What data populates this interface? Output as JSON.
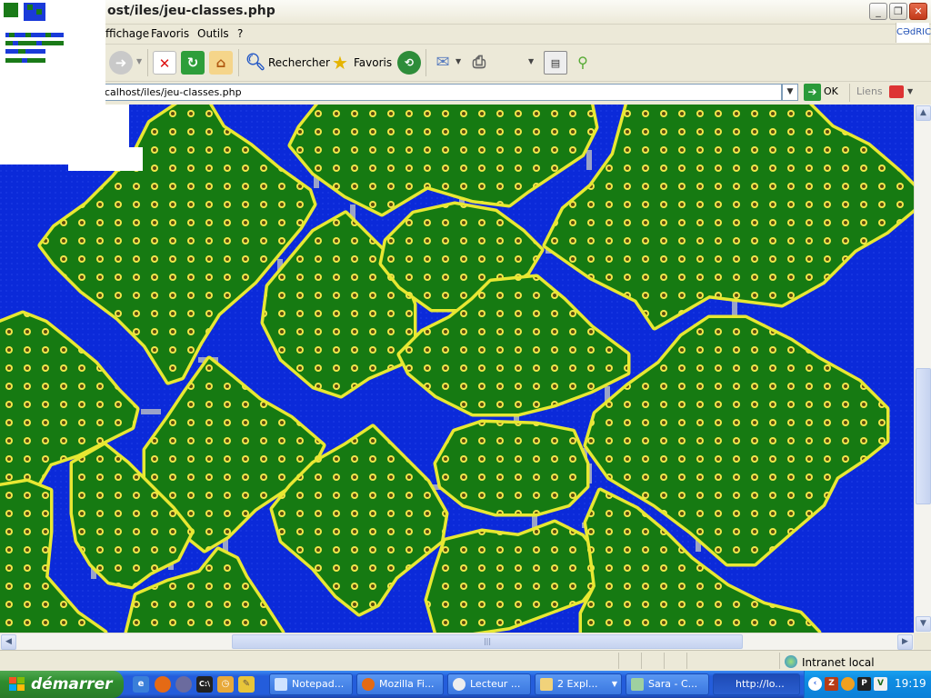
{
  "window": {
    "title": "ost/iles/jeu-classes.php",
    "buttons": {
      "minimize": "_",
      "maximize": "❐",
      "close": "✕"
    }
  },
  "menu": [
    "ffichage",
    "Favoris",
    "Outils",
    "?"
  ],
  "brand": "CƏdRIC",
  "toolbar": {
    "search_label": "Rechercher",
    "favorites_label": "Favoris"
  },
  "address": {
    "url": "calhost/iles/jeu-classes.php",
    "go_label": "OK",
    "links_label": "Liens"
  },
  "status": {
    "zone": "Intranet local"
  },
  "taskbar": {
    "start_label": "démarrer",
    "tasks": [
      {
        "label": "Notepad..."
      },
      {
        "label": "Mozilla Fi..."
      },
      {
        "label": "Lecteur ..."
      },
      {
        "label": "2 Expl..."
      },
      {
        "label": "Sara - C..."
      },
      {
        "label": "http://lo..."
      }
    ],
    "clock": "19:19"
  },
  "colors": {
    "water": "#0b2ad9",
    "island": "#167a12",
    "shore": "#e8e832",
    "bridge": "#9aa3c9"
  }
}
